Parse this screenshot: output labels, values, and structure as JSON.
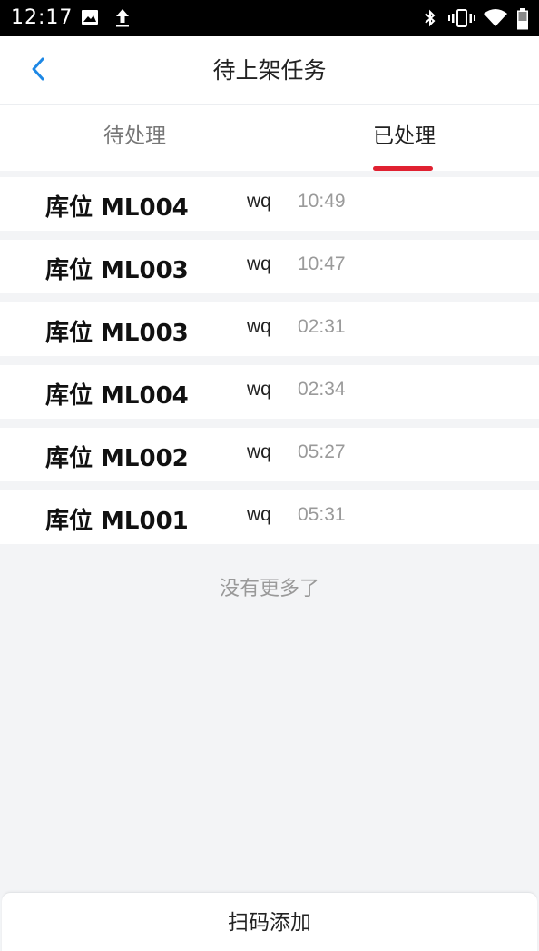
{
  "status_bar": {
    "time": "12:17",
    "left_icons": [
      "image-icon",
      "upload-icon"
    ],
    "right_icons": [
      "bluetooth-icon",
      "vibrate-icon",
      "wifi-icon",
      "battery-icon"
    ]
  },
  "nav": {
    "title": "待上架任务",
    "back_icon": "chevron-left-icon"
  },
  "tabs": [
    {
      "label": "待处理",
      "active": false
    },
    {
      "label": "已处理",
      "active": true
    }
  ],
  "tasks": [
    {
      "location": "库位 ML004",
      "user": "wq",
      "time": "10:49"
    },
    {
      "location": "库位 ML003",
      "user": "wq",
      "time": "10:47"
    },
    {
      "location": "库位 ML003",
      "user": "wq",
      "time": "02:31"
    },
    {
      "location": "库位 ML004",
      "user": "wq",
      "time": "02:34"
    },
    {
      "location": "库位 ML002",
      "user": "wq",
      "time": "05:27"
    },
    {
      "location": "库位 ML001",
      "user": "wq",
      "time": "05:31"
    }
  ],
  "list_footer": "没有更多了",
  "bottom_button": "扫码添加",
  "colors": {
    "accent": "#e02131",
    "back_arrow": "#1e88e5",
    "background": "#f3f4f6"
  }
}
